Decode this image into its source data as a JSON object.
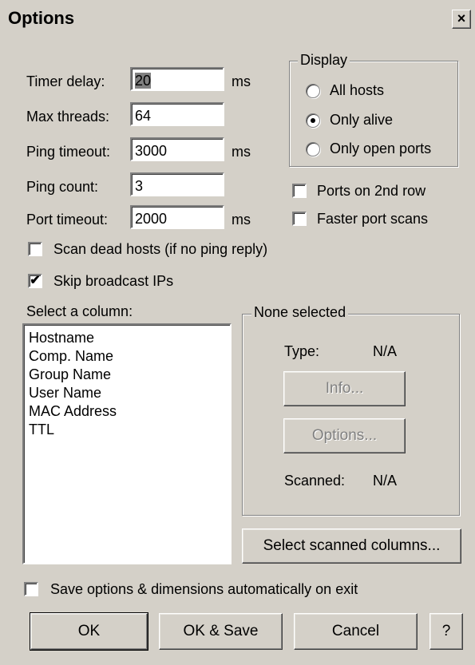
{
  "window": {
    "title": "Options",
    "close_glyph": "×"
  },
  "fields": {
    "timer_delay": {
      "label": "Timer delay:",
      "value": "20",
      "unit": "ms"
    },
    "max_threads": {
      "label": "Max threads:",
      "value": "64"
    },
    "ping_timeout": {
      "label": "Ping timeout:",
      "value": "3000",
      "unit": "ms"
    },
    "ping_count": {
      "label": "Ping count:",
      "value": "3"
    },
    "port_timeout": {
      "label": "Port timeout:",
      "value": "2000",
      "unit": "ms"
    }
  },
  "display": {
    "legend": "Display",
    "options": [
      {
        "label": "All hosts",
        "selected": false
      },
      {
        "label": "Only alive",
        "selected": true
      },
      {
        "label": "Only open ports",
        "selected": false
      }
    ]
  },
  "checkboxes": {
    "ports_2nd_row": {
      "label": "Ports on 2nd row",
      "checked": false
    },
    "faster_port_scans": {
      "label": "Faster port scans",
      "checked": false
    },
    "scan_dead_hosts": {
      "label": "Scan dead hosts (if no ping reply)",
      "checked": false
    },
    "skip_broadcast": {
      "label": "Skip broadcast IPs",
      "checked": true
    },
    "save_options": {
      "label": "Save options & dimensions automatically on exit",
      "checked": false
    }
  },
  "columns": {
    "label": "Select a column:",
    "items": [
      "Hostname",
      "Comp. Name",
      "Group Name",
      "User Name",
      "MAC Address",
      "TTL"
    ]
  },
  "column_info": {
    "legend": "None selected",
    "type_label": "Type:",
    "type_value": "N/A",
    "info_button": "Info...",
    "options_button": "Options...",
    "scanned_label": "Scanned:",
    "scanned_value": "N/A"
  },
  "select_scanned_button": "Select scanned columns...",
  "buttons": {
    "ok": "OK",
    "ok_save": "OK & Save",
    "cancel": "Cancel",
    "help": "?"
  },
  "colors": {
    "dialog_bg": "#d4d0c8",
    "disabled_text": "#808080"
  }
}
